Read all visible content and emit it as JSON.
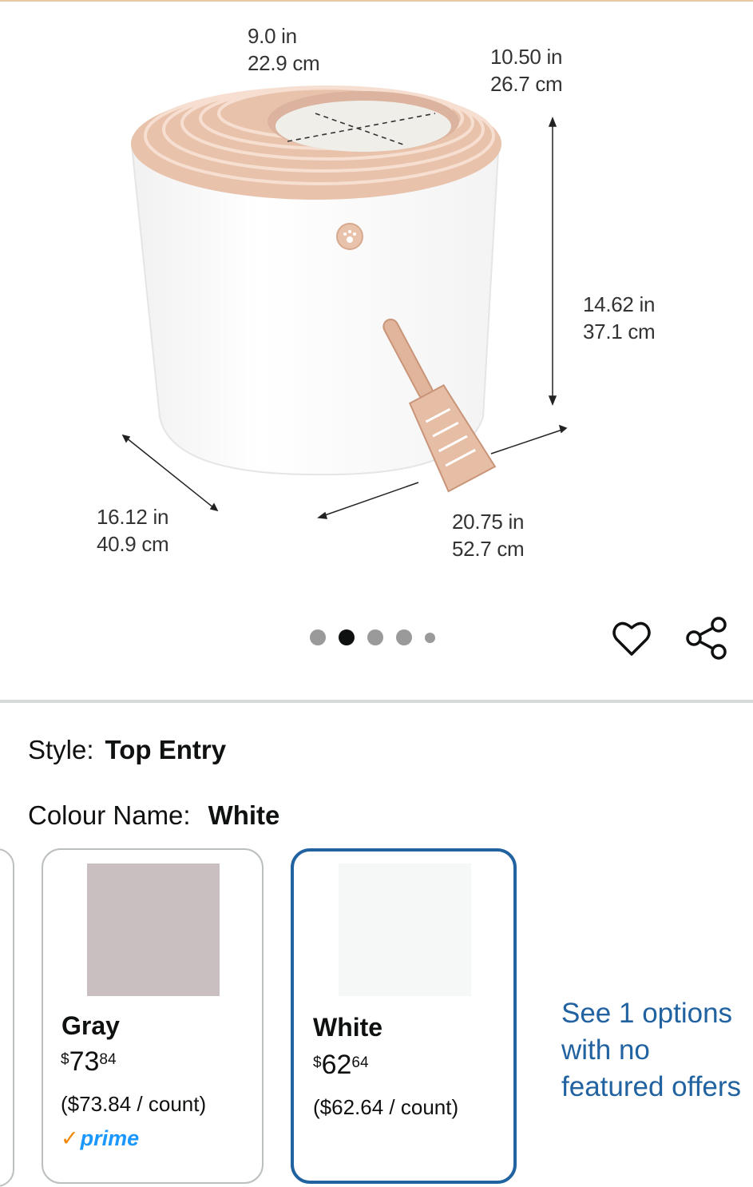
{
  "gallery": {
    "dimensions": {
      "top_width_in": "9.0 in",
      "top_width_cm": "22.9 cm",
      "top_depth_in": "10.50 in",
      "top_depth_cm": "26.7 cm",
      "height_in": "14.62 in",
      "height_cm": "37.1 cm",
      "depth_in": "16.12 in",
      "depth_cm": "40.9 cm",
      "width_in": "20.75 in",
      "width_cm": "52.7 cm"
    },
    "carousel": {
      "count": 5,
      "active_index": 1
    },
    "icons": {
      "wishlist": "heart-icon",
      "share": "share-icon"
    }
  },
  "variation": {
    "style_label": "Style:",
    "style_value": "Top Entry",
    "colour_label": "Colour Name:",
    "colour_value": "White"
  },
  "options": [
    {
      "name": "Gray",
      "currency": "$",
      "price_whole": "73",
      "price_fraction": "84",
      "unit_price": "($73.84 / count)",
      "badge": "prime",
      "swatch_color": "#c9bfc0"
    },
    {
      "name": "White",
      "currency": "$",
      "price_whole": "62",
      "price_fraction": "64",
      "unit_price": "($62.64 / count)",
      "swatch_color": "#f6f8f7"
    }
  ],
  "see_options_link": "See 1 options with no featured offers",
  "colors": {
    "accent": "#2162a1",
    "prime": "#1a98ff",
    "divider": "#d5dbdb"
  }
}
